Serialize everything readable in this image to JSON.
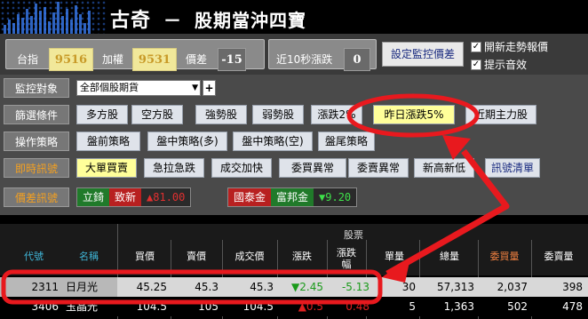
{
  "app": {
    "brand": "古奇",
    "dash": "－",
    "title": "股期當沖四寶"
  },
  "indices": [
    {
      "label": "台指",
      "value": "9516"
    },
    {
      "label": "加權",
      "value": "9531"
    },
    {
      "label": "價差",
      "value": "-15"
    },
    {
      "label": "近10秒漲跌",
      "value": "0"
    }
  ],
  "set_monitor_button": "設定監控價差",
  "checkboxes": [
    {
      "label": "開新走勢報價",
      "checked": true
    },
    {
      "label": "提示音效",
      "checked": true
    }
  ],
  "rows": {
    "monitor": {
      "label": "監控對象",
      "select_value": "全部個股期貨",
      "add": "+"
    },
    "filter": {
      "label": "篩選條件",
      "buttons": [
        "多方股",
        "空方股",
        "強勢股",
        "弱勢股",
        "漲跌2%",
        "昨日漲跌5%",
        "近期主力股"
      ]
    },
    "strategy": {
      "label": "操作策略",
      "buttons": [
        "盤前策略",
        "盤中策略(多)",
        "盤中策略(空)",
        "盤尾策略"
      ]
    },
    "instant": {
      "label": "即時訊號",
      "buttons": [
        "大單買賣",
        "急拉急跌",
        "成交加快",
        "委買異常",
        "委賣異常",
        "新高新低"
      ],
      "clear": "訊號清單"
    },
    "spread": {
      "label": "價差訊號",
      "pairs": [
        {
          "a": "立錡",
          "b": "致新",
          "value": "▲81.00"
        },
        {
          "a": "國泰金",
          "b": "富邦金",
          "value": "▼9.20"
        }
      ]
    }
  },
  "table": {
    "group_header": "股票",
    "columns": [
      "代號",
      "名稱",
      "買價",
      "賣價",
      "成交價",
      "漲跌",
      "漲跌\n幅",
      "單量",
      "總量",
      "委買量",
      "委賣量"
    ],
    "rows": [
      [
        "2311",
        "日月光",
        "45.25",
        "45.3",
        "45.3",
        "▼2.45",
        "-5.13",
        "30",
        "57,313",
        "2,037",
        "398"
      ],
      [
        "3406",
        "玉晶光",
        "104.5",
        "105",
        "104.5",
        "▲0.5",
        "0.48",
        "5",
        "1,363",
        "502",
        "478"
      ]
    ]
  },
  "colors": {
    "accent_red": "#e02020",
    "highlight_yellow": "#ffff9a",
    "index_yellow": "#f1e89a"
  }
}
